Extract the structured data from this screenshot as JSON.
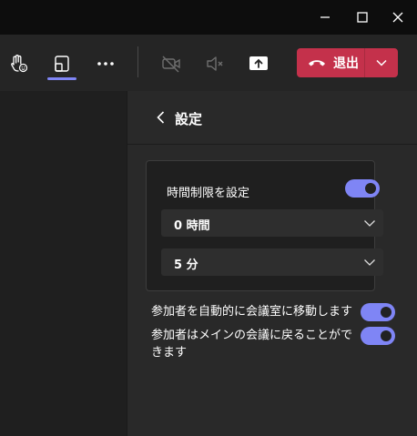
{
  "window": {
    "controls": [
      "minimize-icon",
      "maximize-icon",
      "close-icon"
    ]
  },
  "toolbar": {
    "icons": [
      "raise-hand-icon",
      "breakout-rooms-icon",
      "more-options-icon",
      "camera-off-icon",
      "mic-muted-icon",
      "share-screen-icon"
    ],
    "leave_label": "退出",
    "leave_color": "#c4314b",
    "accent_color": "#7f85f5"
  },
  "panel": {
    "title": "設定",
    "time_limit": {
      "label": "時間制限を設定",
      "enabled": true,
      "hours_value": "0 時間",
      "minutes_value": "5 分"
    },
    "auto_move": {
      "label": "参加者を自動的に会議室に移動します",
      "enabled": true
    },
    "return_main": {
      "label": "参加者はメインの会議に戻ることができます",
      "enabled": true
    }
  }
}
